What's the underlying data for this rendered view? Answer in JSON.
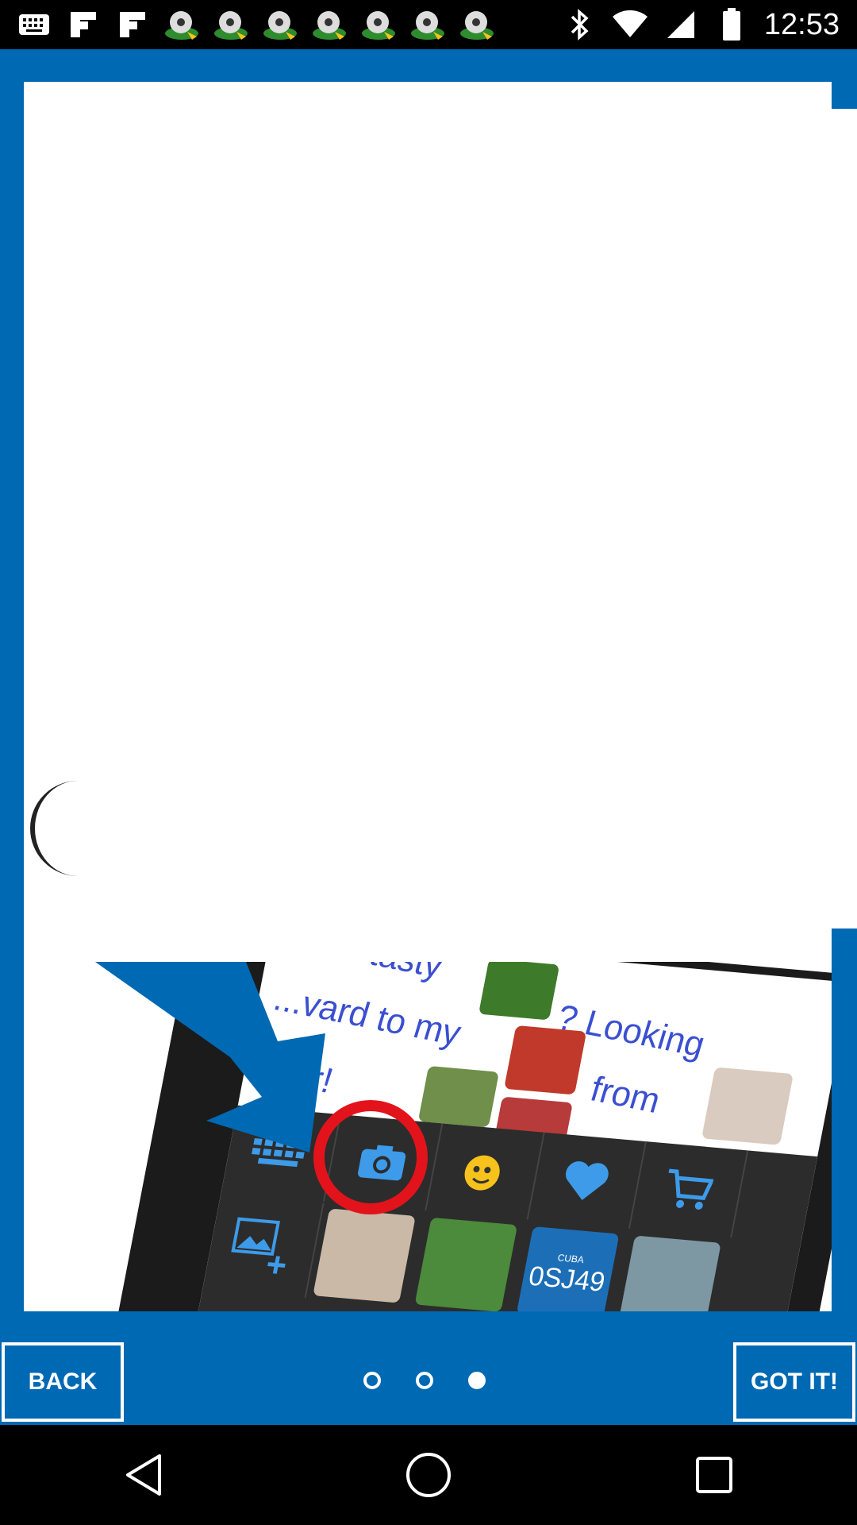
{
  "status_bar": {
    "time": "12:53",
    "left_icons": [
      "keyboard-icon",
      "flipboard-icon",
      "flipboard-icon",
      "soccer-ball-icon",
      "soccer-ball-icon",
      "soccer-ball-icon",
      "soccer-ball-icon",
      "soccer-ball-icon",
      "soccer-ball-icon",
      "soccer-ball-icon"
    ],
    "right_icons": [
      "bluetooth-icon",
      "wifi-icon",
      "signal-icon",
      "battery-icon"
    ]
  },
  "tutorial": {
    "screen_text": {
      "line1": "...me tasty",
      "line2": "? Looking",
      "line3": "...vard to my",
      "line4": "from",
      "line5": "tr...ar!"
    },
    "plate_text": "0SJ49",
    "plate_small": "CUBA"
  },
  "bottom_bar": {
    "back_label": "BACK",
    "got_it_label": "GOT IT!",
    "page_count": 3,
    "current_page": 3
  },
  "colors": {
    "primary_blue": "#0069b4",
    "highlight_red": "#e3131b"
  },
  "nav": [
    "back-icon",
    "home-icon",
    "recents-icon"
  ]
}
